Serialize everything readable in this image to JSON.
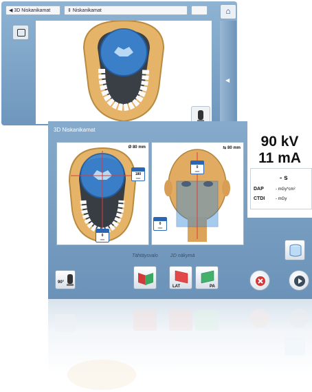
{
  "back_window": {
    "breadcrumb_1": "◀ 3D Niskanikamat",
    "breadcrumb_2": "⇕ Niskanikamat",
    "home_icon": "home-icon",
    "side_arrow": "◀"
  },
  "front_window": {
    "title": "3D Niskanikamat",
    "left_panel": {
      "fov_label": "Ø 80 mm",
      "height_box": {
        "value": "180",
        "unit": "mm"
      },
      "bottom_box": {
        "value": "0",
        "unit": "mm"
      }
    },
    "right_panel": {
      "fov_label": "⇆ 80 mm",
      "top_box": {
        "value": "0",
        "unit": "mm"
      },
      "left_box": {
        "value": "0",
        "unit": "mm"
      }
    },
    "exposure": {
      "kv": "90 kV",
      "ma": "11 mA",
      "time": "- s",
      "dap_label": "DAP",
      "dap_value": "- mGy*cm²",
      "ctdi_label": "CTDI",
      "ctdi_value": "- mGy"
    },
    "sections": {
      "star_view": "Tähtäysvalo",
      "view_2d": "2D näkymä"
    },
    "buttons": {
      "rotate_label": "90°",
      "lat_label": "LAT",
      "pa_label": "PA"
    }
  },
  "colors": {
    "window_blue": "#6f97bd",
    "fov_blue": "#2f7fd0",
    "accent_red": "#d23a3a",
    "play_dark": "#3a4c5e"
  }
}
